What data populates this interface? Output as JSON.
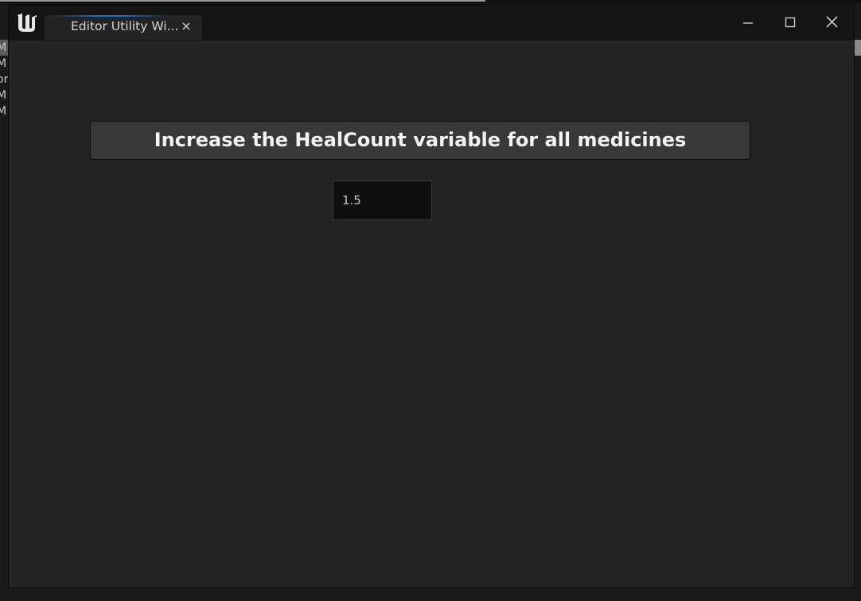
{
  "window": {
    "tab_title": "Editor Utility Wi...",
    "tab_close_glyph": "×",
    "logo_icon": "unreal-engine-logo-icon",
    "controls": {
      "minimize_icon": "minimize-icon",
      "maximize_icon": "maximize-icon",
      "close_icon": "close-icon"
    }
  },
  "background": {
    "list_items": [
      "M",
      "M",
      "or",
      "M",
      "M"
    ]
  },
  "widget": {
    "button_label": "Increase the HealCount variable for all medicines",
    "input_value": "1.5"
  },
  "colors": {
    "window_bg": "#242424",
    "titlebar_bg": "#141414",
    "button_bg": "#383838",
    "input_bg": "#0f0f0f",
    "tab_accent": "#1e6ed2"
  }
}
